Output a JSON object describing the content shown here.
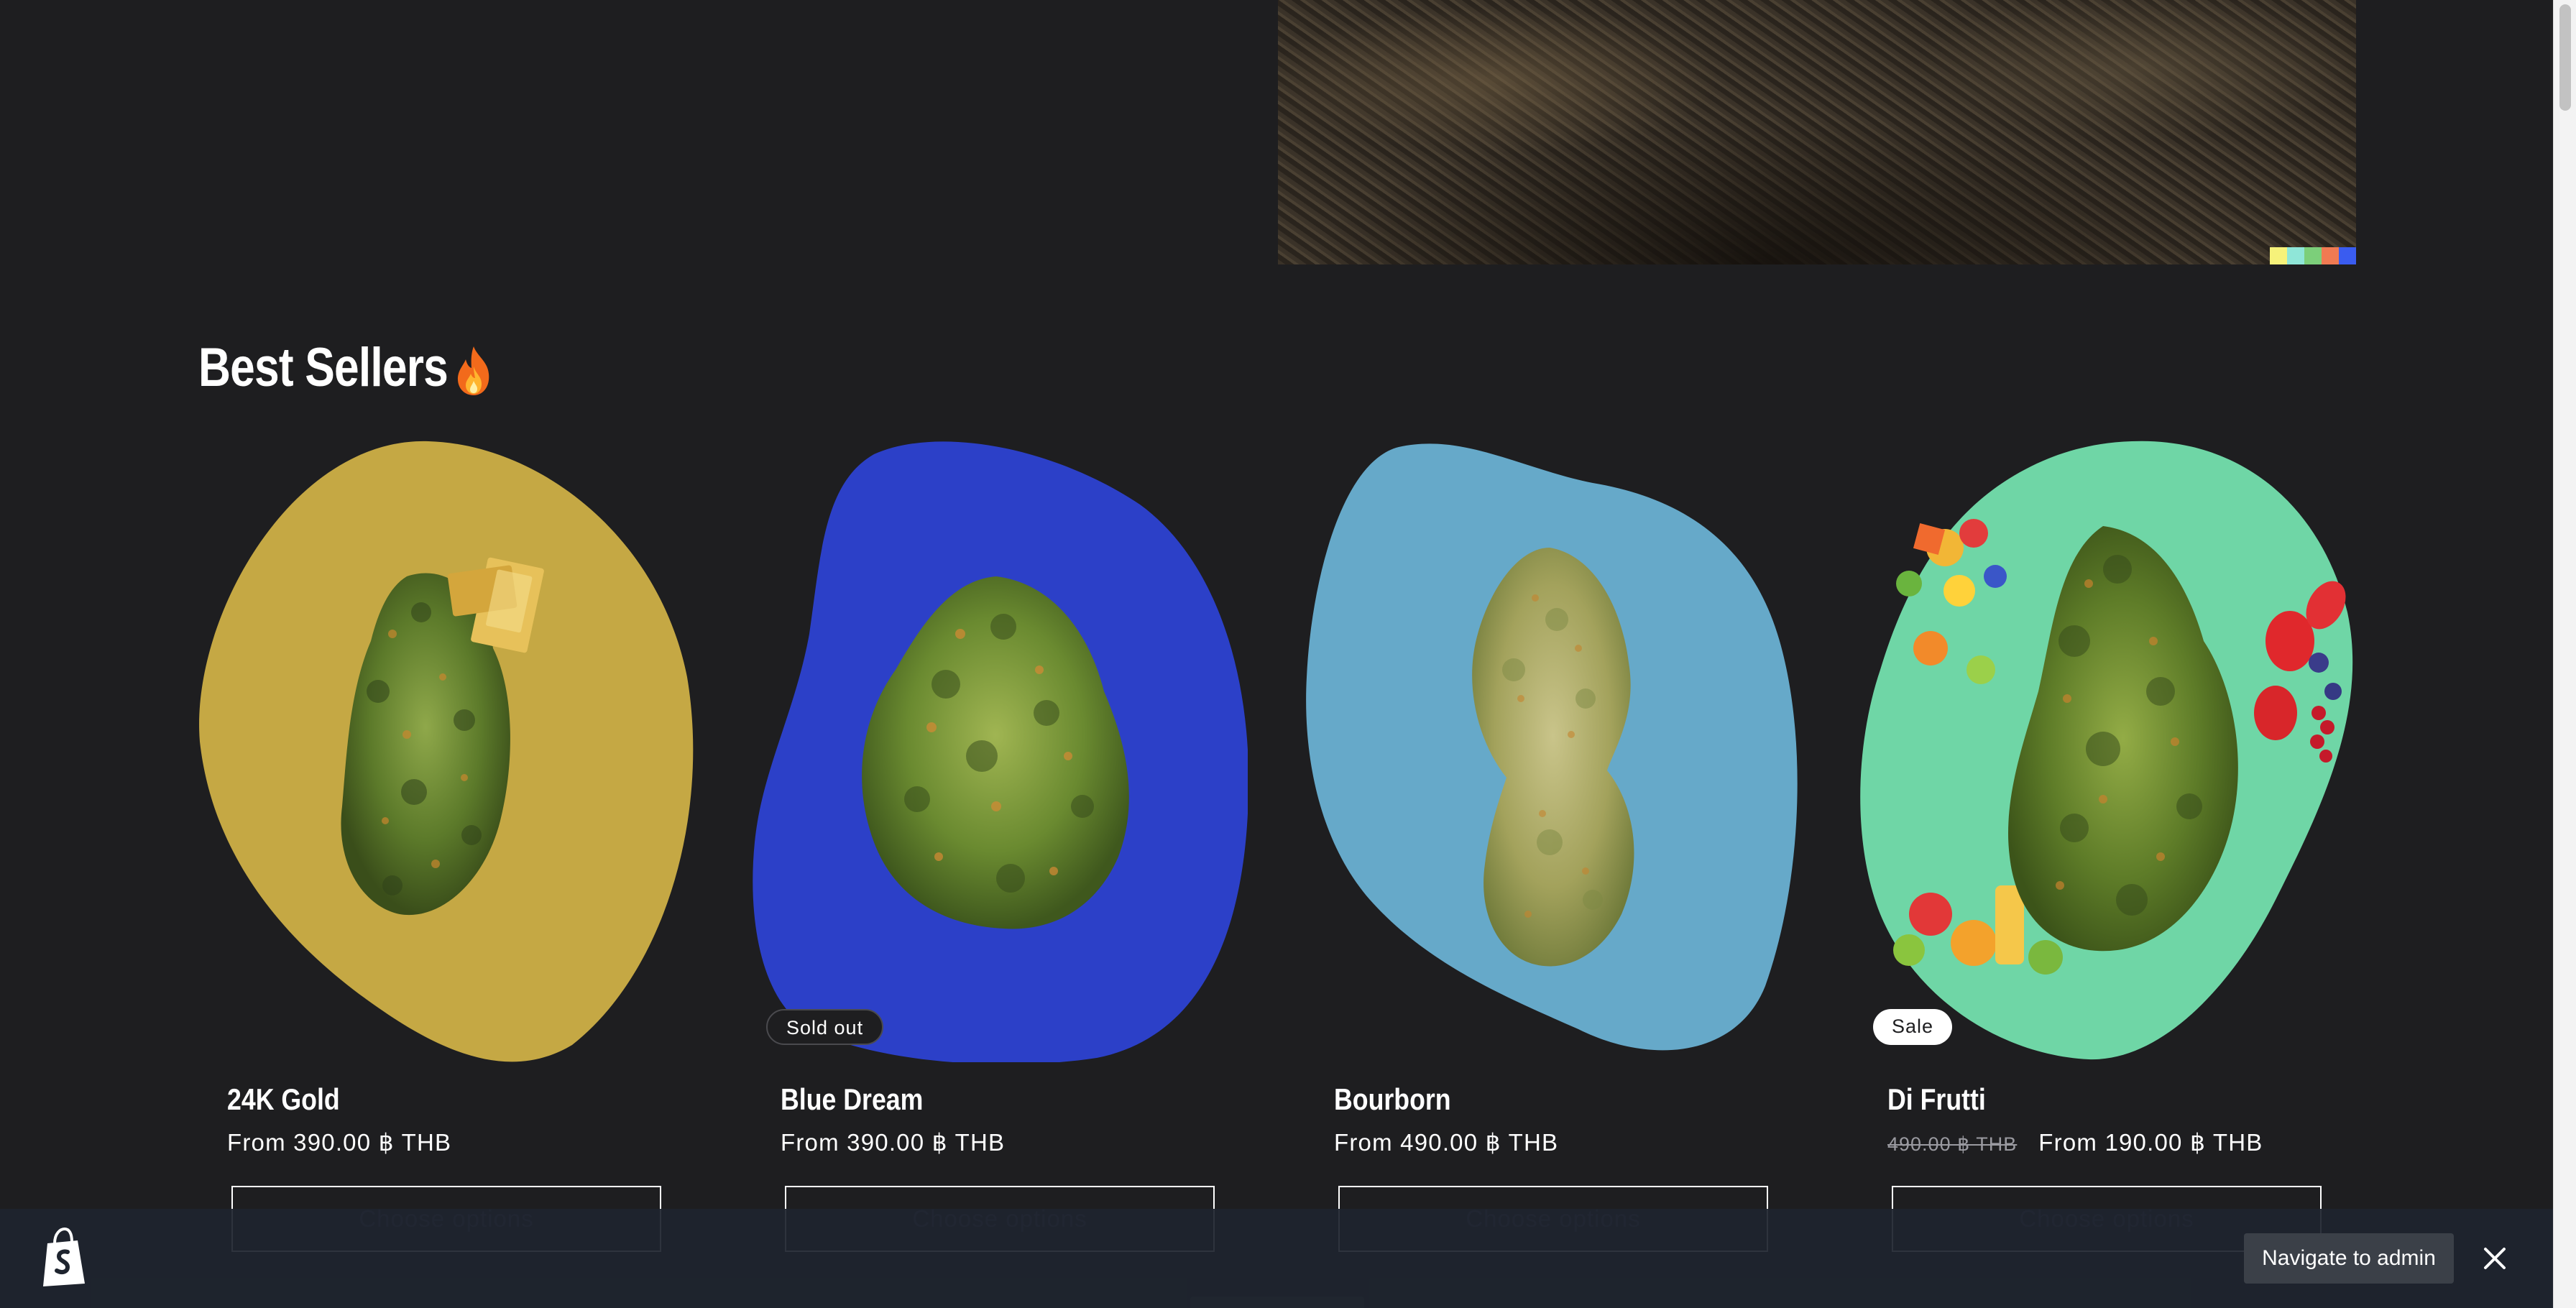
{
  "section": {
    "title": "Best Sellers",
    "icon": "fire-icon"
  },
  "hero": {
    "icon": "textured-rock-image",
    "strip_colors": [
      "#f6f27a",
      "#8fe6d8",
      "#7ccf7a",
      "#f07a52",
      "#3a5cf0"
    ]
  },
  "products": [
    {
      "name": "24K Gold",
      "price": "From 390.00 ฿ THB",
      "old_price": "",
      "badge": "",
      "button": "Choose options",
      "blob_color": "#c5a844",
      "icon": "cannabis-bud-with-gold-bars-image"
    },
    {
      "name": "Blue Dream",
      "price": "From 390.00 ฿ THB",
      "old_price": "",
      "badge": "Sold out",
      "button": "Choose options",
      "blob_color": "#2c40c8",
      "icon": "cannabis-bud-image"
    },
    {
      "name": "Bourborn",
      "price": "From 490.00 ฿ THB",
      "old_price": "",
      "badge": "",
      "button": "Choose options",
      "blob_color": "#66a9c9",
      "icon": "cannabis-bud-image"
    },
    {
      "name": "Di Frutti",
      "price": "From 190.00 ฿ THB",
      "old_price": "490.00 ฿ THB",
      "badge": "Sale",
      "button": "Choose options",
      "blob_color": "#6fd6a6",
      "icon": "cannabis-bud-with-fruits-image"
    }
  ],
  "admin_bar": {
    "navigate_label": "Navigate to admin",
    "logo_icon": "shopify-bag-icon",
    "close_icon": "close-icon"
  }
}
